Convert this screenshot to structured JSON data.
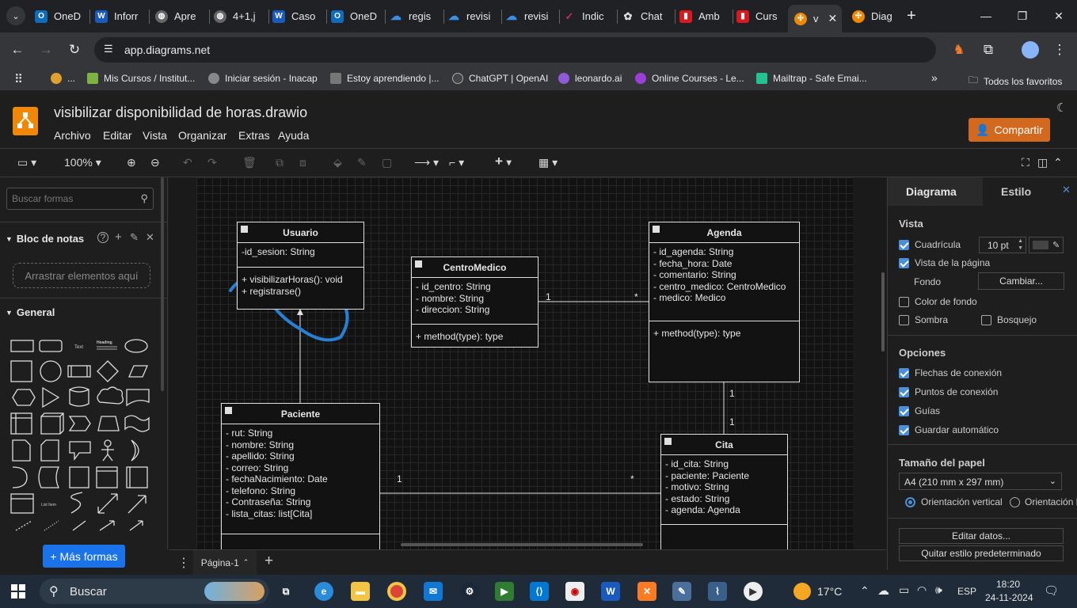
{
  "browser": {
    "tabs": [
      {
        "label": "OneD",
        "icon": "outlook-icon",
        "color": "#0f6cbd"
      },
      {
        "label": "Inforr",
        "icon": "word-icon",
        "color": "#185abd"
      },
      {
        "label": "Apre",
        "icon": "globe-icon",
        "color": "#666"
      },
      {
        "label": "4+1,j",
        "icon": "globe-icon",
        "color": "#666"
      },
      {
        "label": "Caso",
        "icon": "word-icon",
        "color": "#185abd"
      },
      {
        "label": "OneD",
        "icon": "outlook-icon",
        "color": "#0f6cbd"
      },
      {
        "label": "regis",
        "icon": "onedrive-icon",
        "color": "#3a8ee6"
      },
      {
        "label": "revisi",
        "icon": "onedrive-icon",
        "color": "#3a8ee6"
      },
      {
        "label": "revisi",
        "icon": "onedrive-icon",
        "color": "#3a8ee6"
      },
      {
        "label": "Indic",
        "icon": "chart-icon",
        "color": "#c4314b"
      },
      {
        "label": "Chat",
        "icon": "openai-icon",
        "color": "#444"
      },
      {
        "label": "Amb",
        "icon": "inacap-icon",
        "color": "#d71920"
      },
      {
        "label": "Curs",
        "icon": "inacap-icon",
        "color": "#d71920"
      },
      {
        "label": "v",
        "icon": "drawio-icon",
        "color": "#f08705"
      },
      {
        "label": "Diag",
        "icon": "drawio-icon",
        "color": "#f08705"
      }
    ],
    "url": "app.diagrams.net",
    "bookmarks": [
      {
        "label": "...",
        "color": "#e0a030"
      },
      {
        "label": "Mis Cursos / Institut...",
        "color": "#7cb342"
      },
      {
        "label": "Iniciar sesión - Inacap",
        "color": "#888"
      },
      {
        "label": "Estoy aprendiendo |...",
        "color": "#777"
      },
      {
        "label": "ChatGPT | OpenAI",
        "color": "#444"
      },
      {
        "label": "leonardo.ai",
        "color": "#8e5ad6"
      },
      {
        "label": "Online Courses - Le...",
        "color": "#9b3fd6"
      },
      {
        "label": "Mailtrap - Safe Emai...",
        "color": "#22c38e"
      }
    ],
    "all_bookmarks": "Todos los favoritos"
  },
  "app": {
    "title": "visibilizar disponibilidad de horas.drawio",
    "menu": [
      "Archivo",
      "Editar",
      "Vista",
      "Organizar",
      "Extras",
      "Ayuda"
    ],
    "share": "Compartir",
    "zoom": "100%"
  },
  "left": {
    "search_placeholder": "Buscar formas",
    "scratchpad": "Bloc de notas",
    "dropzone": "Arrastrar elementos aquí",
    "general": "General",
    "more_shapes": "+ Más formas",
    "shape_text": "Text",
    "shape_heading": "Heading",
    "shape_listitem": "List Item"
  },
  "diagram": {
    "usuario": {
      "title": "Usuario",
      "attrs": [
        "-id_sesion: String"
      ],
      "methods": [
        "+ visibilizarHoras(): void",
        "+ registrarse()"
      ]
    },
    "centro": {
      "title": "CentroMedico",
      "attrs": [
        "- id_centro: String",
        "- nombre: String",
        "- direccion: String"
      ],
      "methods": [
        "+ method(type): type"
      ]
    },
    "agenda": {
      "title": "Agenda",
      "attrs": [
        "- id_agenda: String",
        "- fecha_hora: Date",
        "- comentario: String",
        "- centro_medico: CentroMedico",
        "- medico: Medico"
      ],
      "methods": [
        "+ method(type): type"
      ]
    },
    "paciente": {
      "title": "Paciente",
      "attrs": [
        "- rut: String",
        "- nombre: String",
        "- apellido: String",
        "- correo: String",
        "- fechaNacimiento: Date",
        "- telefono: String",
        "- Contraseña: String",
        "- lista_citas: list[Cita]"
      ]
    },
    "cita": {
      "title": "Cita",
      "attrs": [
        "- id_cita: String",
        "- paciente: Paciente",
        "- motivo: String",
        "- estado: String",
        "- agenda: Agenda"
      ]
    },
    "labels": {
      "centro_agenda_1": "1",
      "centro_agenda_many": "*",
      "agenda_cita_1a": "1",
      "agenda_cita_1b": "1",
      "paciente_cita_1": "1",
      "paciente_cita_many": "*"
    }
  },
  "page_tab": "Página-1",
  "right": {
    "tab_diagram": "Diagrama",
    "tab_style": "Estilo",
    "vista": "Vista",
    "grid": "Cuadrícula",
    "grid_size": "10 pt",
    "page_view": "Vista de la página",
    "background": "Fondo",
    "change": "Cambiar...",
    "bg_color": "Color de fondo",
    "shadow": "Sombra",
    "sketch": "Bosquejo",
    "options": "Opciones",
    "conn_arrows": "Flechas de conexión",
    "conn_points": "Puntos de conexión",
    "guides": "Guías",
    "autosave": "Guardar automático",
    "paper_size": "Tamaño del papel",
    "paper_value": "A4 (210 mm x 297 mm)",
    "portrait": "Orientación vertical",
    "landscape": "Orientación h",
    "edit_data": "Editar datos...",
    "remove_style": "Quitar estilo predeterminado"
  },
  "taskbar": {
    "search": "Buscar",
    "temp": "17°C",
    "lang": "ESP",
    "time": "18:20",
    "date": "24-11-2024"
  }
}
